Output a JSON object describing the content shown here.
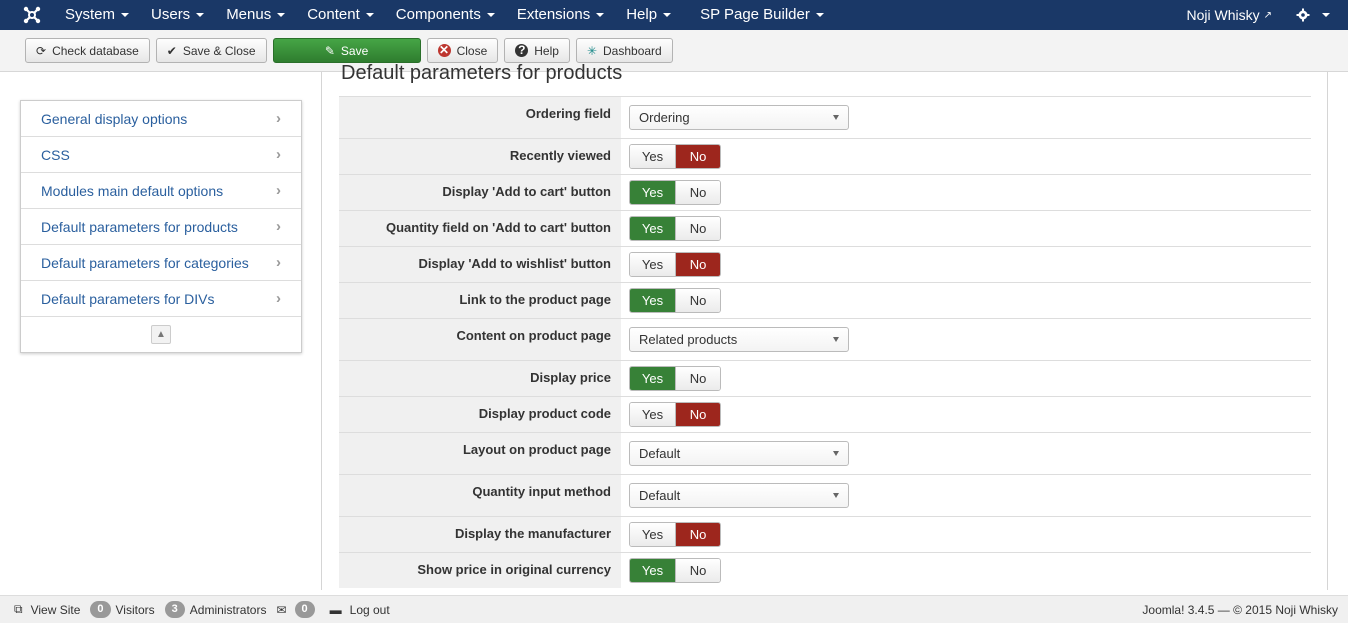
{
  "navbar": {
    "menus": [
      "System",
      "Users",
      "Menus",
      "Content",
      "Components",
      "Extensions",
      "Help",
      "SP Page Builder"
    ],
    "user": "Noji Whisky"
  },
  "toolbar": {
    "check_database": "Check database",
    "save_close": "Save & Close",
    "save": "Save",
    "close": "Close",
    "help": "Help",
    "dashboard": "Dashboard"
  },
  "sidebar": {
    "items": [
      {
        "label": "General display options"
      },
      {
        "label": "CSS"
      },
      {
        "label": "Modules main default options"
      },
      {
        "label": "Default parameters for products"
      },
      {
        "label": "Default parameters for categories"
      },
      {
        "label": "Default parameters for DIVs"
      }
    ]
  },
  "main": {
    "title": "Default parameters for products",
    "rows": [
      {
        "label": "Ordering field",
        "type": "select",
        "value": "Ordering"
      },
      {
        "label": "Recently viewed",
        "type": "toggle",
        "value": "No"
      },
      {
        "label": "Display 'Add to cart' button",
        "type": "toggle",
        "value": "Yes"
      },
      {
        "label": "Quantity field on 'Add to cart' button",
        "type": "toggle",
        "value": "Yes"
      },
      {
        "label": "Display 'Add to wishlist' button",
        "type": "toggle",
        "value": "No"
      },
      {
        "label": "Link to the product page",
        "type": "toggle",
        "value": "Yes"
      },
      {
        "label": "Content on product page",
        "type": "select",
        "value": "Related products"
      },
      {
        "label": "Display price",
        "type": "toggle",
        "value": "Yes"
      },
      {
        "label": "Display product code",
        "type": "toggle",
        "value": "No"
      },
      {
        "label": "Layout on product page",
        "type": "select",
        "value": "Default"
      },
      {
        "label": "Quantity input method",
        "type": "select",
        "value": "Default"
      },
      {
        "label": "Display the manufacturer",
        "type": "toggle",
        "value": "No"
      },
      {
        "label": "Show price in original currency",
        "type": "toggle",
        "value": "Yes"
      }
    ],
    "yes_label": "Yes",
    "no_label": "No"
  },
  "statusbar": {
    "view_site": "View Site",
    "visitors_count": "0",
    "visitors": "Visitors",
    "admins_count": "3",
    "administrators": "Administrators",
    "messages_count": "0",
    "logout": "Log out",
    "copyright": "Joomla! 3.4.5 — © 2015 Noji Whisky"
  },
  "colors": {
    "navbar": "#1a3867",
    "yes_active": "#378137",
    "no_active": "#9d261d",
    "link": "#2a5f9e"
  }
}
